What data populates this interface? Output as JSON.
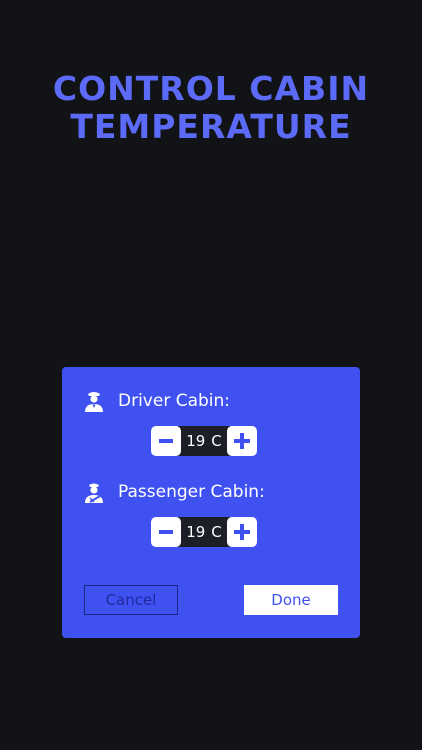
{
  "header": {
    "title_line1": "CONTROL CABIN",
    "title_line2": "TEMPERATURE"
  },
  "dialog": {
    "driver": {
      "label": "Driver Cabin:",
      "value": "19",
      "unit": "C",
      "icon": "driver-icon"
    },
    "passenger": {
      "label": "Passenger Cabin:",
      "value": "19",
      "unit": "C",
      "icon": "passenger-icon"
    },
    "cancel_label": "Cancel",
    "done_label": "Done"
  },
  "colors": {
    "background": "#121317",
    "accent": "#3F51F0",
    "headline": "#5B6BF7"
  }
}
